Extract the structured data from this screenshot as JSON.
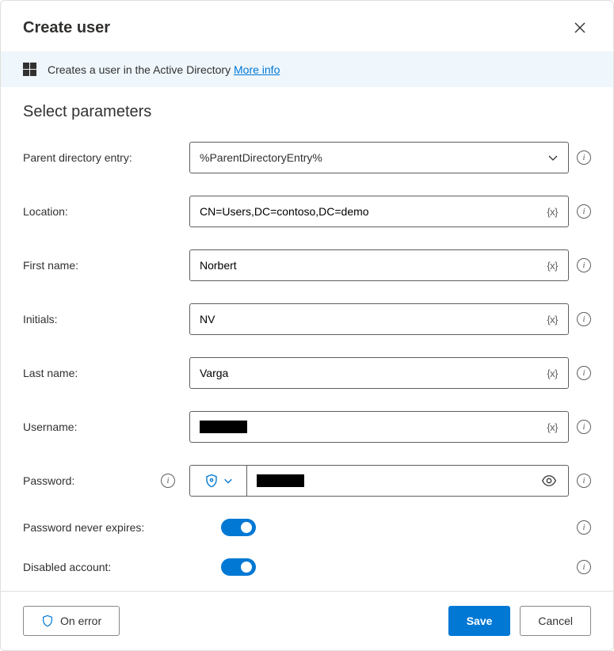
{
  "header": {
    "title": "Create user"
  },
  "infoBar": {
    "text": "Creates a user in the Active Directory ",
    "linkText": "More info"
  },
  "section": {
    "heading": "Select parameters"
  },
  "fields": {
    "parentDirectory": {
      "label": "Parent directory entry:",
      "value": "%ParentDirectoryEntry%"
    },
    "location": {
      "label": "Location:",
      "value": "CN=Users,DC=contoso,DC=demo",
      "varBadge": "{x}"
    },
    "firstName": {
      "label": "First name:",
      "value": "Norbert",
      "varBadge": "{x}"
    },
    "initials": {
      "label": "Initials:",
      "value": "NV",
      "varBadge": "{x}"
    },
    "lastName": {
      "label": "Last name:",
      "value": "Varga",
      "varBadge": "{x}"
    },
    "username": {
      "label": "Username:",
      "value": "",
      "varBadge": "{x}"
    },
    "password": {
      "label": "Password:",
      "value": ""
    },
    "passwordNeverExpires": {
      "label": "Password never expires:",
      "on": true
    },
    "disabledAccount": {
      "label": "Disabled account:",
      "on": true
    }
  },
  "footer": {
    "onError": "On error",
    "save": "Save",
    "cancel": "Cancel"
  }
}
